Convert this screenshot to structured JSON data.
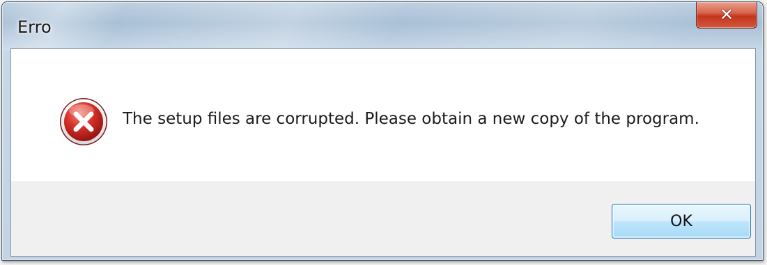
{
  "window": {
    "title": "Erro"
  },
  "title_bar": {
    "close_icon": "close-icon",
    "close_glyph": "✕"
  },
  "message": {
    "icon": "error-icon",
    "text": "The setup files are corrupted. Please obtain a new copy of the program."
  },
  "buttons": {
    "ok_label": "OK"
  },
  "colors": {
    "error_red": "#c8102e",
    "close_red": "#c3361d",
    "ok_border": "#3c7fb1",
    "button_area_bg": "#f0f0f0"
  }
}
